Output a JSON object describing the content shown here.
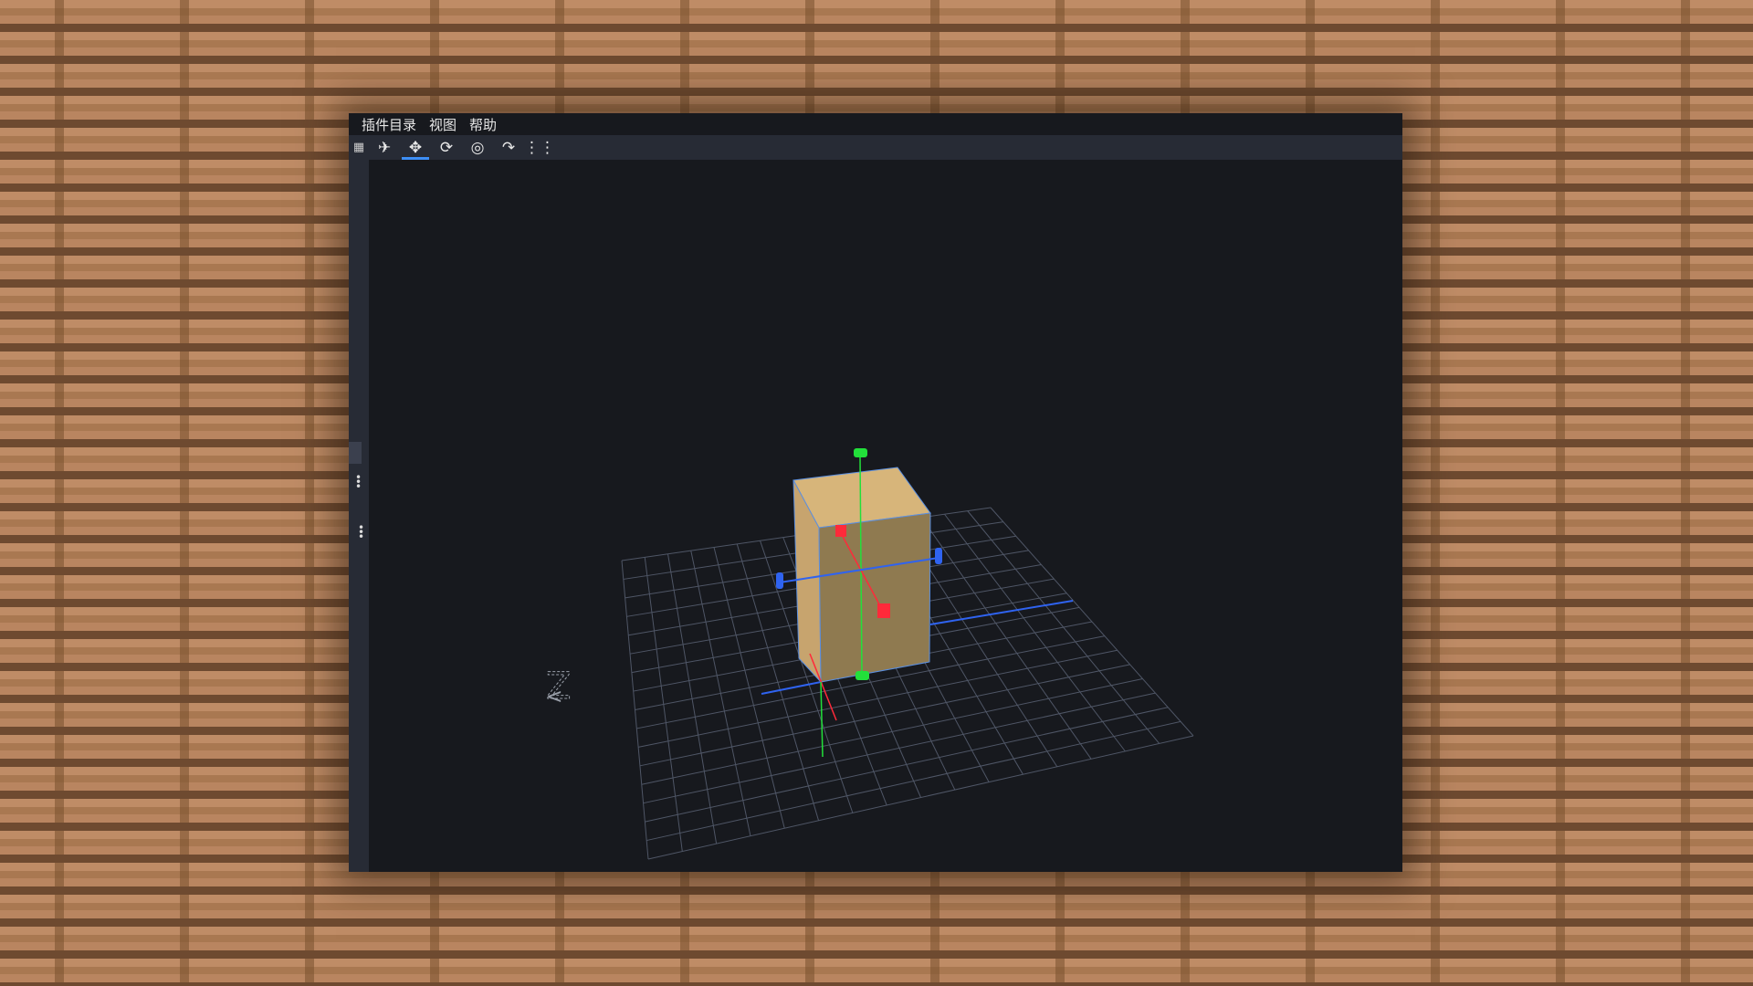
{
  "menu": {
    "items": [
      {
        "label": "插件目录"
      },
      {
        "label": "视图"
      },
      {
        "label": "帮助"
      }
    ]
  },
  "toolbar": {
    "tools": [
      {
        "icon": "grid-icon",
        "glyph": "▦"
      },
      {
        "icon": "pin-icon",
        "glyph": "✈"
      },
      {
        "icon": "move-icon",
        "glyph": "✥",
        "active": true
      },
      {
        "icon": "rotate-icon",
        "glyph": "⟳"
      },
      {
        "icon": "pivot-icon",
        "glyph": "◎"
      },
      {
        "icon": "vertex-snap-icon",
        "glyph": "↷"
      },
      {
        "icon": "more-icon",
        "glyph": "⋮⋮"
      }
    ],
    "accent": "#3d8ef5"
  },
  "viewport": {
    "axis_label": "Z",
    "cube_colors": {
      "top": "#d7b57a",
      "front": "#8f7a50",
      "left": "#c7a46e"
    },
    "gizmo_colors": {
      "x": "#ff2a3a",
      "y": "#22e03a",
      "z": "#2f63f0"
    }
  }
}
